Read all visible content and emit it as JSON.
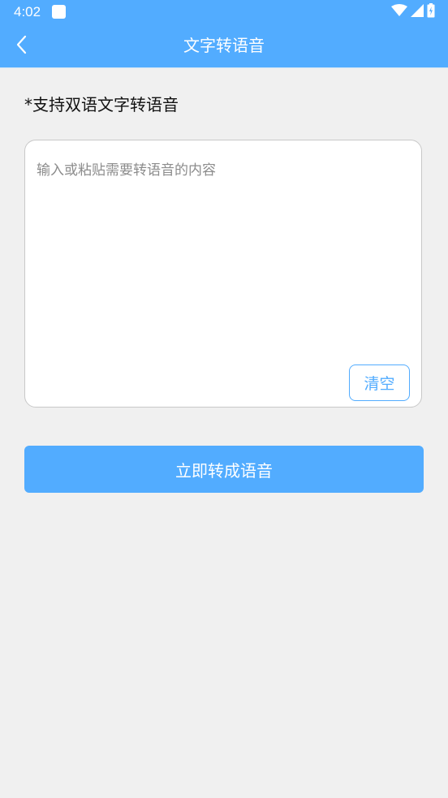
{
  "status_bar": {
    "time": "4:02",
    "icons": [
      "app-notification-icon",
      "wifi-icon",
      "signal-icon",
      "battery-charging-icon"
    ]
  },
  "app_bar": {
    "title": "文字转语音",
    "back_icon": "chevron-left-icon"
  },
  "main": {
    "hint": "*支持双语文字转语音",
    "input": {
      "value": "",
      "placeholder": "输入或粘贴需要转语音的内容"
    },
    "clear_label": "清空",
    "convert_label": "立即转成语音"
  },
  "colors": {
    "primary": "#52acff",
    "background": "#f0f0f0",
    "card": "#ffffff"
  }
}
